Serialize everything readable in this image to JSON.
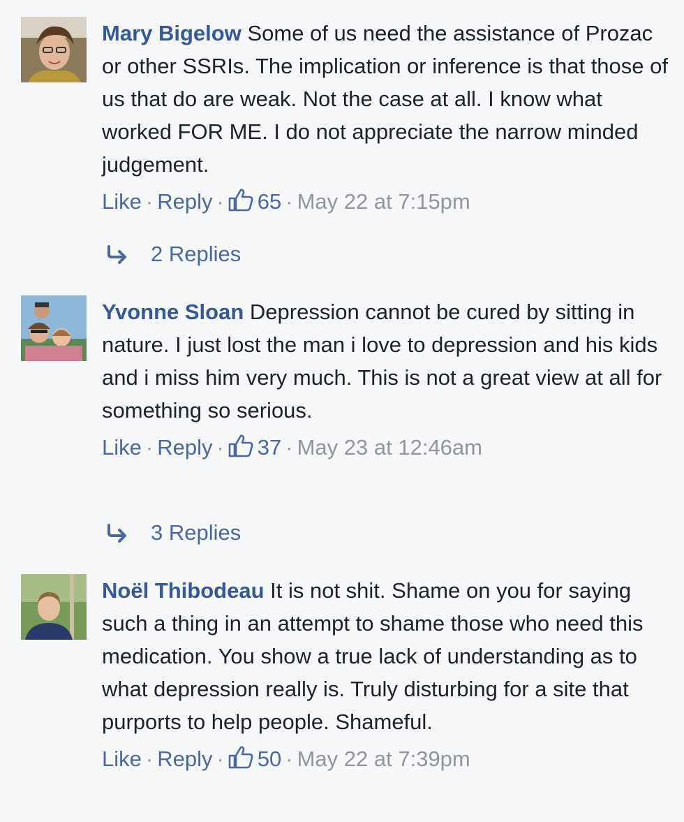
{
  "comments": [
    {
      "author": "Mary Bigelow",
      "text": "Some of us need the assistance of Prozac or other SSRIs. The implication or inference is that those of us that do are weak. Not the case at all. I know what worked FOR ME. I do not appreciate the narrow minded judgement.",
      "like_label": "Like",
      "reply_label": "Reply",
      "likes": "65",
      "timestamp": "May 22 at 7:15pm",
      "replies_label": "2 Replies"
    },
    {
      "author": "Yvonne Sloan",
      "text": "Depression cannot be cured by sitting in nature. I just lost the man i love to depression and his kids and i miss him very much. This is not a great view at all for something so serious.",
      "like_label": "Like",
      "reply_label": "Reply",
      "likes": "37",
      "timestamp": "May 23 at 12:46am",
      "replies_label": "3 Replies"
    },
    {
      "author": "Noël Thibodeau",
      "text": "It is not shit. Shame on you for saying such a thing in an attempt to shame those who need this medication. You show a true lack of understanding as to what depression really is. Truly disturbing for a site that purports to help people. Shameful.",
      "like_label": "Like",
      "reply_label": "Reply",
      "likes": "50",
      "timestamp": "May 22 at 7:39pm"
    }
  ],
  "colors": {
    "background": "#f6f7f9",
    "link": "#365899",
    "action_link": "#4b67a1",
    "muted": "#90949c",
    "text": "#1d2129"
  },
  "icons": {
    "like": "thumbs-up-icon",
    "replies": "reply-arrow-icon"
  }
}
